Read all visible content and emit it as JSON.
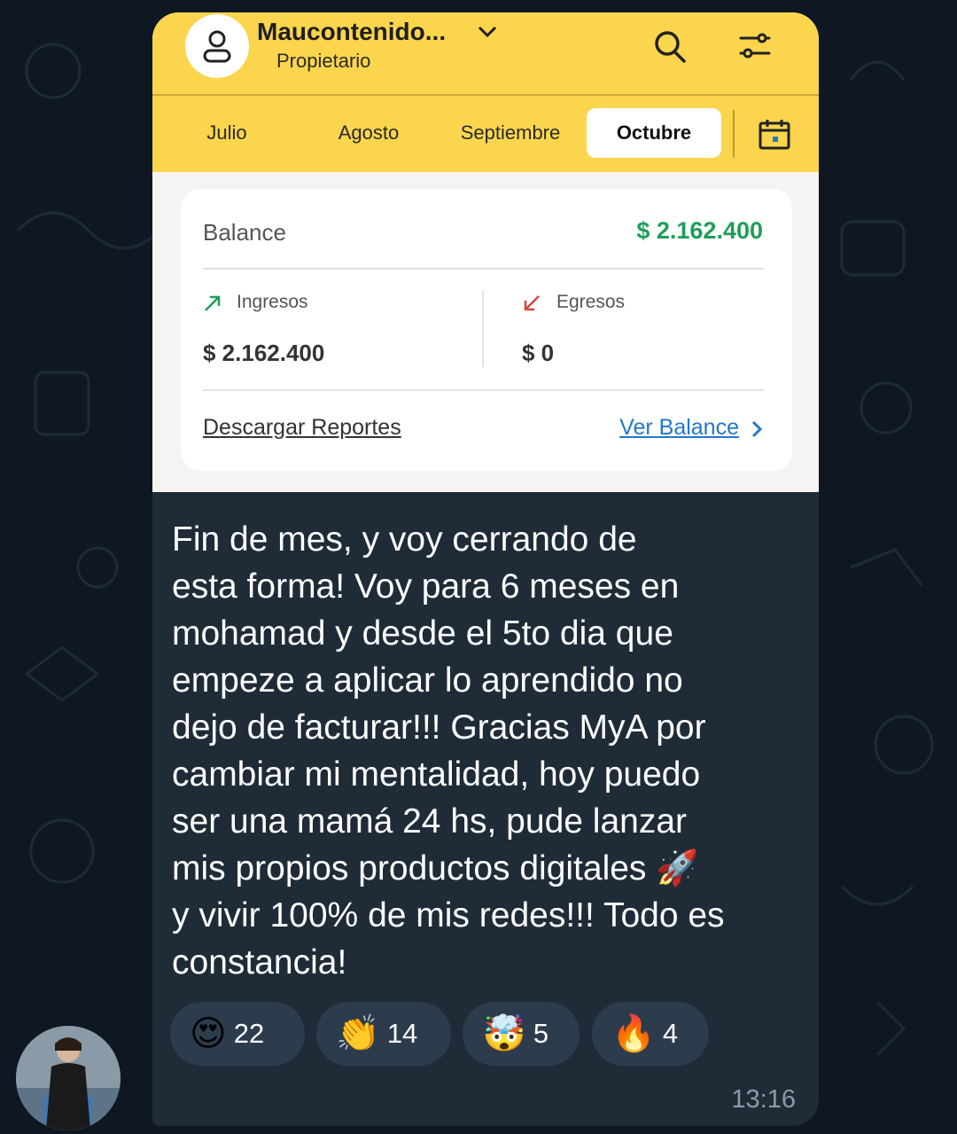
{
  "app": {
    "account_name": "Maucontenido...",
    "account_role": "Propietario",
    "months": [
      "Julio",
      "Agosto",
      "Septiembre",
      "Octubre"
    ],
    "active_month": "Octubre",
    "balance": {
      "label": "Balance",
      "value": "$ 2.162.400",
      "income_label": "Ingresos",
      "income_value": "$ 2.162.400",
      "expense_label": "Egresos",
      "expense_value": "$ 0",
      "download_link": "Descargar Reportes",
      "view_link": "Ver Balance"
    },
    "colors": {
      "header": "#fbd54d",
      "positive": "#1f9e5a",
      "link": "#2477c9",
      "negative": "#d9463a"
    }
  },
  "message": {
    "lines": [
      "Fin de mes, y voy cerrando de",
      "esta forma! Voy para 6 meses en",
      "mohamad y desde el 5to dia que",
      "empeze a aplicar lo aprendido no",
      "dejo de facturar!!! Gracias MyA por",
      "cambiar mi mentalidad, hoy puedo",
      "ser una mamá 24 hs, pude lanzar",
      "mis propios productos digitales 🚀",
      "y vivir 100% de mis redes!!! Todo es",
      "constancia!"
    ],
    "time": "13:16",
    "reactions": [
      {
        "emoji": "😍",
        "count": "22"
      },
      {
        "emoji": "👏",
        "count": "14"
      },
      {
        "emoji": "🤯",
        "count": "5"
      },
      {
        "emoji": "🔥",
        "count": "4"
      }
    ]
  }
}
